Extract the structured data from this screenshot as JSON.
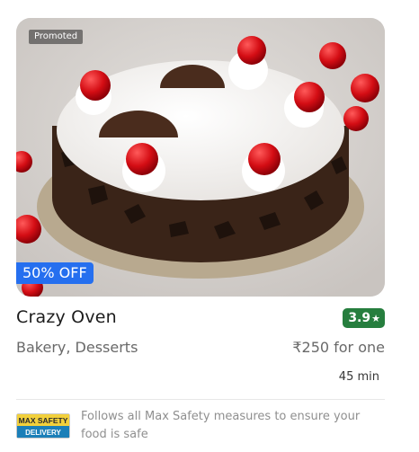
{
  "card": {
    "promoted_label": "Promoted",
    "offer_label": "50% OFF",
    "restaurant_name": "Crazy Oven",
    "rating": "3.9",
    "rating_star": "★",
    "cuisines": "Bakery, Desserts",
    "price": "₹250 for one",
    "delivery_time": "45 min",
    "safety_badge_line1": "MAX SAFETY",
    "safety_badge_line2": "DELIVERY",
    "safety_text": "Follows all Max Safety measures to ensure your food is safe"
  },
  "colors": {
    "rating_bg": "#267e3e",
    "offer_bg": "#256fef",
    "text_primary": "#1c1c1c",
    "text_secondary": "#696969"
  },
  "images": {
    "hero": "black-forest-cake-photo"
  }
}
